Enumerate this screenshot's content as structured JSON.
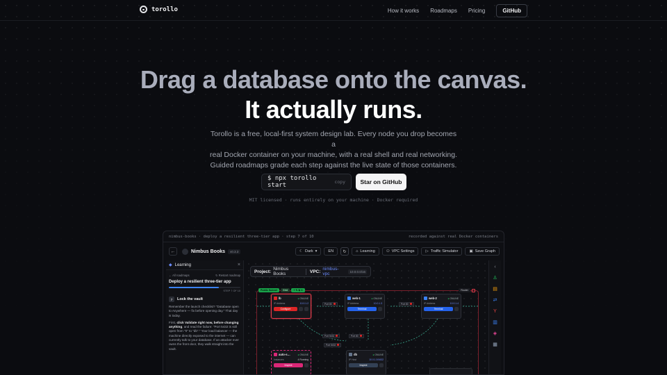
{
  "brand": {
    "name": "torollo"
  },
  "nav": {
    "links": [
      "How it works",
      "Roadmaps",
      "Pricing"
    ],
    "github": "GitHub"
  },
  "hero": {
    "line1": "Drag a database onto the canvas.",
    "line2": "It actually runs.",
    "sub1": "Torollo is a free, local-first system design lab. Every node you drop becomes a",
    "sub2": "real Docker container on your machine, with a real shell and real networking.",
    "sub3": "Guided roadmaps grade each step against the live state of those containers.",
    "command": "$ npx torollo start",
    "copy": "copy",
    "star": "Star on GitHub",
    "meta": "MIT licensed · runs entirely on your machine · Docker required"
  },
  "frame": {
    "left": "nimbus-books · deploy a resilient three-tier app · step 7 of 10",
    "right": "recorded against real Docker containers"
  },
  "toolbar": {
    "back": "←",
    "title": "Nimbus Books",
    "version": "v0.3.3",
    "theme": "Dark",
    "lang": "EN",
    "refresh": "↻",
    "learning": "Learning",
    "vpc_settings": "VPC Settings",
    "traffic": "Traffic Simulator",
    "save": "Save Graph"
  },
  "sidebar": {
    "title": "Learning",
    "close": "×",
    "all_roadmaps": "← All roadmaps",
    "restart": "↻ Restart roadmap",
    "roadmap_title": "Deploy a resilient three-tier app",
    "progress": 0.7,
    "step_count": "STEP 7 OF 10",
    "step_num": "7",
    "step_title": "Lock the vault",
    "p1": "Remember the launch checklist? \"Database open to Anywhere — fix before opening day.\" That day is today.",
    "p2_a": "First, ",
    "p2_b": "click Validate right now, before changing anything",
    "p2_c": ", and read the failure: \"Port 5432 is still open from \"0\" to \"db\".\" Your load balancer — the machine directly exposed to the internet — can currently talk to your database. If an attacker ever owns the front door, they walk straight into the vault."
  },
  "canvas": {
    "project_label": "Project:",
    "project": "Nimbus Books",
    "vpc_label": "VPC:",
    "vpc": "nimbus-vpc",
    "cidr": "10.0.0.0/16",
    "subnet_tag": "Public Subnet",
    "subnet_extra": "Grid",
    "subnet_icons": "+ ✎ ⧉ ✕",
    "router": "Router",
    "nodes": [
      {
        "name": "lb",
        "status": "ONLINE",
        "label": "IP Address",
        "value": "10.0.1.2",
        "action": "Configure"
      },
      {
        "name": "web-1",
        "status": "ONLINE",
        "label": "IP Address",
        "value": "10.0.1.3",
        "action": "Terminal"
      },
      {
        "name": "web-2",
        "status": "ONLINE",
        "label": "IP Address",
        "value": "10.0.1.4",
        "action": "Terminal"
      },
      {
        "name": "auto-s…",
        "status": "ONLINE",
        "label": "Instances",
        "value": "4 Running",
        "action": "Inspect"
      },
      {
        "name": "db",
        "status": "ONLINE",
        "label": "IP Host",
        "value": "10.0.1.5:5432",
        "action": "Inspect"
      }
    ],
    "ports": [
      "Port 80",
      "Port 80",
      "Port 80",
      "Port 5432",
      "Port 5432",
      "Port 80"
    ]
  },
  "colors": {
    "accent": "#3b82f6",
    "danger": "#dc2626",
    "success": "#22c55e",
    "subnet_green": "#19a34a"
  },
  "rail_icons": [
    "chevron-left-icon",
    "network-icon",
    "stack-icon",
    "arrows-icon",
    "branch-icon",
    "database-icon",
    "layers-icon",
    "cylinder-icon"
  ]
}
